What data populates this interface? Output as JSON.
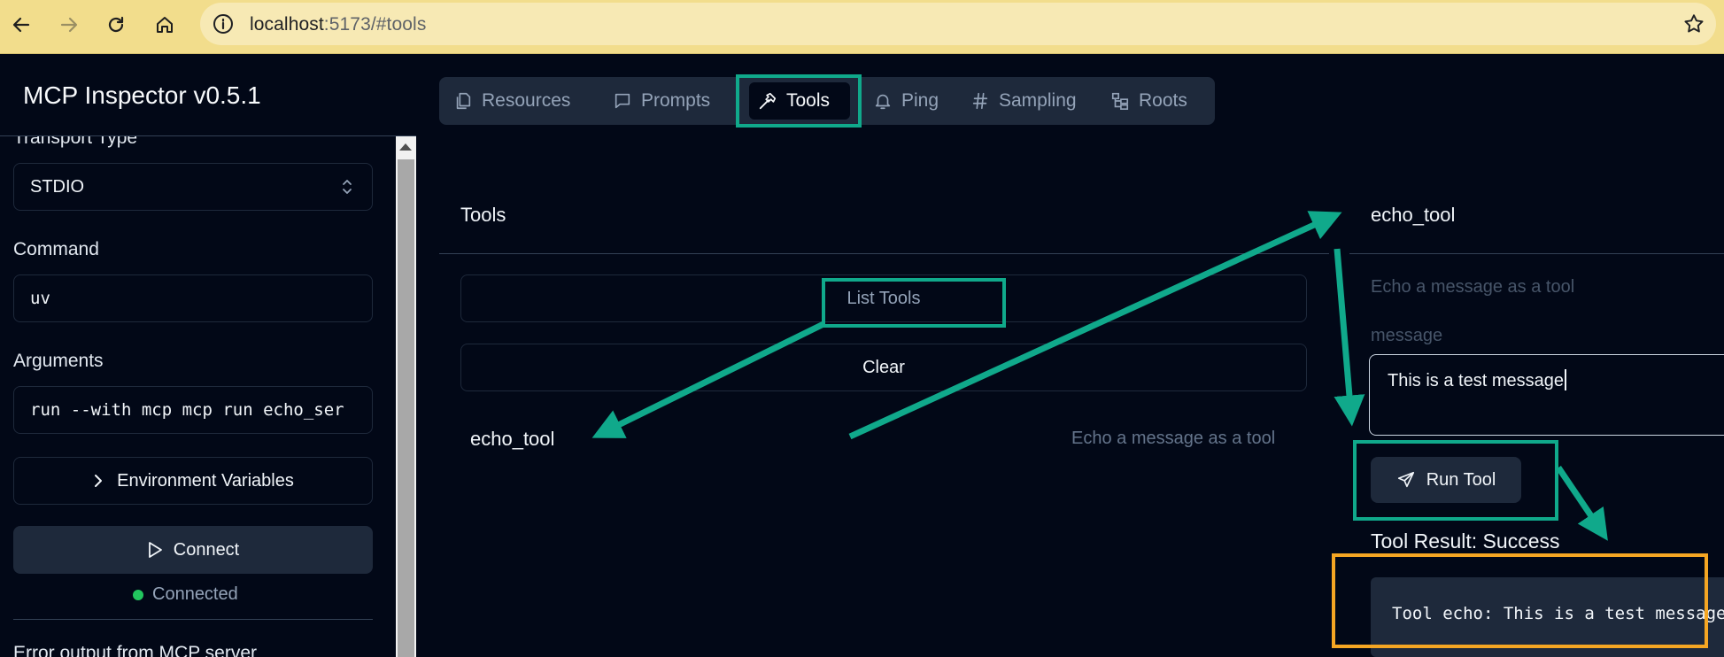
{
  "browser": {
    "url_host": "localhost",
    "url_rest": ":5173/#tools"
  },
  "sidebar": {
    "app_title": "MCP Inspector v0.5.1",
    "transport_label": "Transport Type",
    "transport_value": "STDIO",
    "command_label": "Command",
    "command_value": "uv",
    "arguments_label": "Arguments",
    "arguments_value": "run --with mcp mcp run echo_ser",
    "env_button": "Environment Variables",
    "connect_button": "Connect",
    "status": "Connected",
    "error_output_label": "Error output from MCP server"
  },
  "tabs": [
    {
      "label": "Resources",
      "icon": "files-icon"
    },
    {
      "label": "Prompts",
      "icon": "message-square-icon"
    },
    {
      "label": "Tools",
      "icon": "hammer-icon"
    },
    {
      "label": "Ping",
      "icon": "bell-icon"
    },
    {
      "label": "Sampling",
      "icon": "hash-icon"
    },
    {
      "label": "Roots",
      "icon": "folder-tree-icon"
    }
  ],
  "active_tab": "Tools",
  "tools_panel": {
    "title": "Tools",
    "list_button": "List Tools",
    "clear_button": "Clear",
    "items": [
      {
        "name": "echo_tool",
        "description": "Echo a message as a tool"
      }
    ]
  },
  "tool_detail": {
    "title": "echo_tool",
    "description": "Echo a message as a tool",
    "param_label": "message",
    "param_value": "This is a test message",
    "run_button": "Run Tool",
    "result_title": "Tool Result: Success",
    "result_text": "Tool echo: This is a test message"
  },
  "colors": {
    "highlight": "#10a98b",
    "result_highlight": "#f5a623",
    "status_ok": "#22c55e"
  }
}
